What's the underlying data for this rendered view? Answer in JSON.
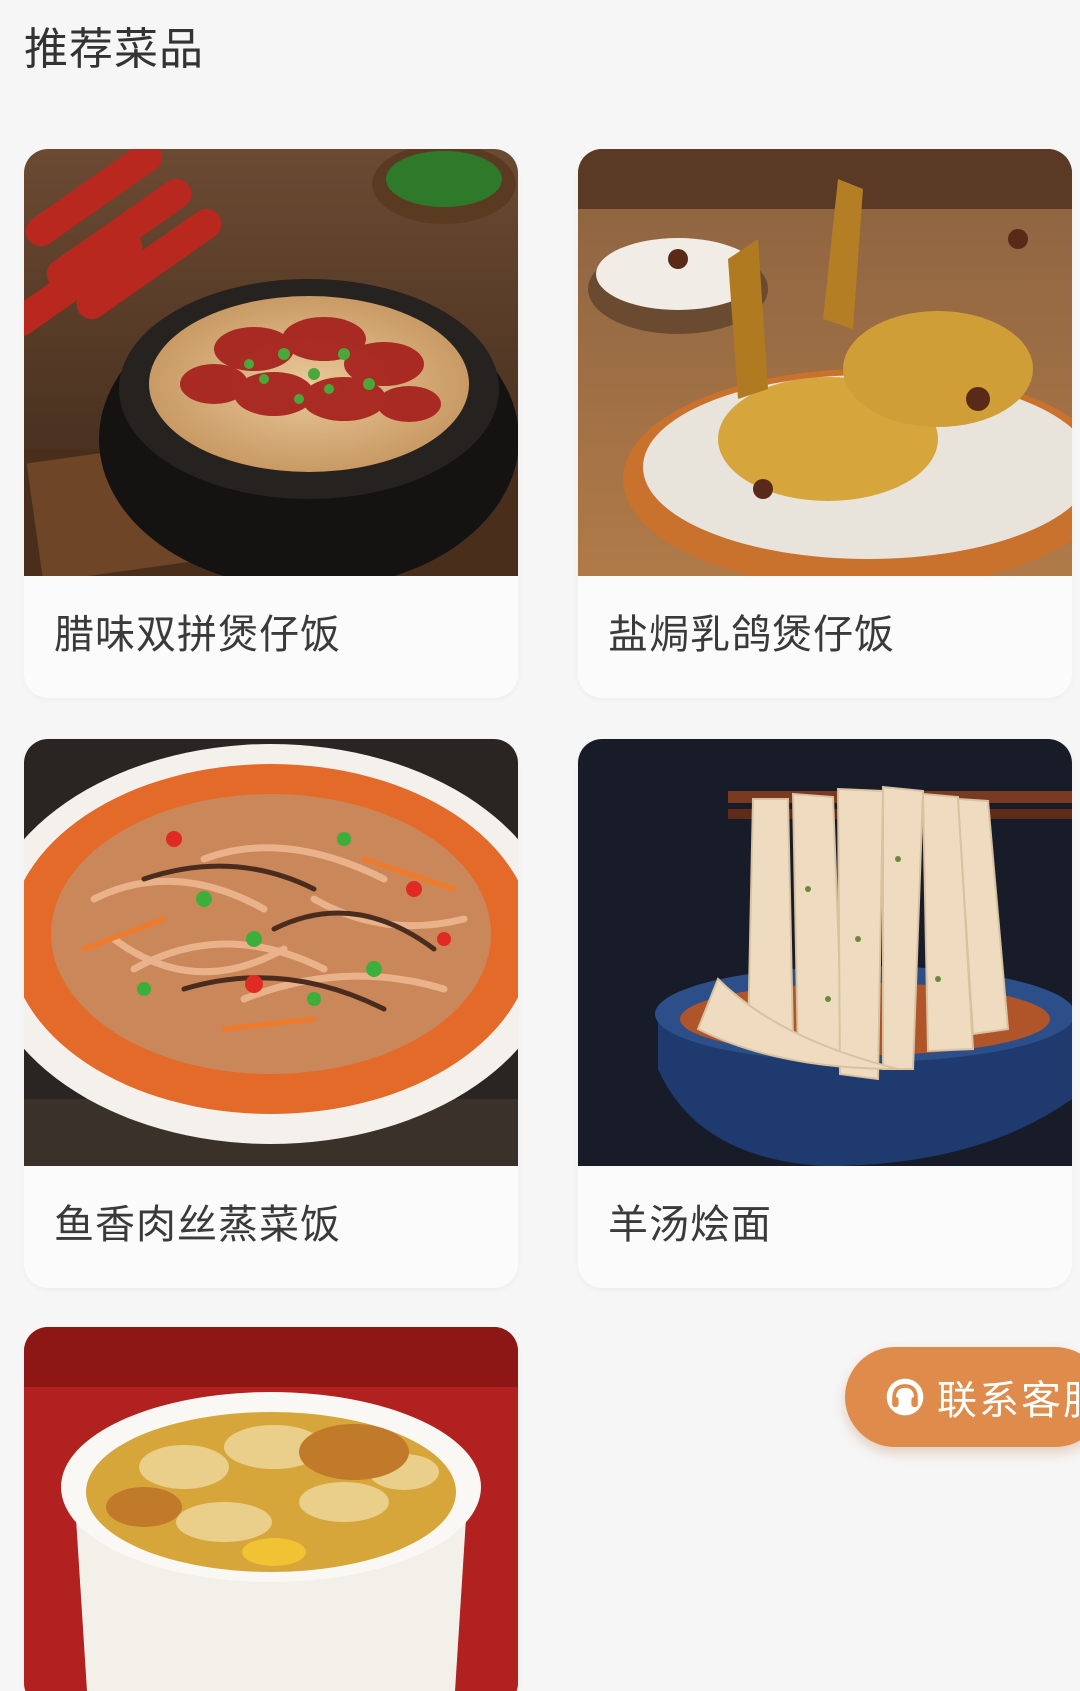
{
  "section": {
    "title": "推荐菜品"
  },
  "dishes": [
    {
      "name": "腊味双拼煲仔饭",
      "image_icon": "claypot-rice-image"
    },
    {
      "name": "盐焗乳鸽煲仔饭",
      "image_icon": "salt-baked-pigeon-image"
    },
    {
      "name": "鱼香肉丝蒸菜饭",
      "image_icon": "shredded-pork-image"
    },
    {
      "name": "羊汤烩面",
      "image_icon": "lamb-noodles-image"
    },
    {
      "name": "",
      "image_icon": "chicken-soup-pot-image"
    }
  ],
  "contact_button": {
    "label": "联系客服",
    "icon": "headset-icon"
  },
  "colors": {
    "accent": "#de8b4b",
    "background": "#f6f6f6",
    "card": "#fbfbfb"
  }
}
